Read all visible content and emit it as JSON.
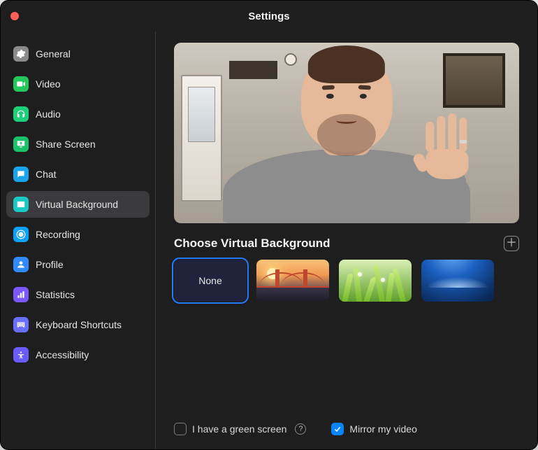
{
  "window": {
    "title": "Settings"
  },
  "sidebar": {
    "items": [
      {
        "key": "general",
        "label": "General",
        "color": "#8a8a8a"
      },
      {
        "key": "video",
        "label": "Video",
        "color": "#24c75a"
      },
      {
        "key": "audio",
        "label": "Audio",
        "color": "#1ecf7a"
      },
      {
        "key": "share-screen",
        "label": "Share Screen",
        "color": "#19c26b"
      },
      {
        "key": "chat",
        "label": "Chat",
        "color": "#1aa5ea"
      },
      {
        "key": "virtual-background",
        "label": "Virtual Background",
        "color": "#18c8c3"
      },
      {
        "key": "recording",
        "label": "Recording",
        "color": "#0aa2ff"
      },
      {
        "key": "profile",
        "label": "Profile",
        "color": "#2f8bff"
      },
      {
        "key": "statistics",
        "label": "Statistics",
        "color": "#7b57ff"
      },
      {
        "key": "keyboard-shortcuts",
        "label": "Keyboard Shortcuts",
        "color": "#6b6fff"
      },
      {
        "key": "accessibility",
        "label": "Accessibility",
        "color": "#6a5cff"
      }
    ],
    "active_key": "virtual-background"
  },
  "main": {
    "section_title": "Choose Virtual Background",
    "backgrounds": [
      {
        "key": "none",
        "label": "None",
        "selected": true
      },
      {
        "key": "golden-gate-bridge",
        "label": "Golden Gate Bridge",
        "selected": false
      },
      {
        "key": "grass",
        "label": "Grass",
        "selected": false
      },
      {
        "key": "earth-from-space",
        "label": "Earth from Space",
        "selected": false
      }
    ],
    "add_button_title": "Add Image"
  },
  "footer": {
    "green_screen": {
      "label": "I have a green screen",
      "checked": false
    },
    "mirror": {
      "label": "Mirror my video",
      "checked": true
    },
    "help_tooltip": "Help"
  },
  "colors": {
    "accent": "#0a84ff",
    "panel": "#1e1e1e",
    "selected_row": "#3b3b3e"
  }
}
